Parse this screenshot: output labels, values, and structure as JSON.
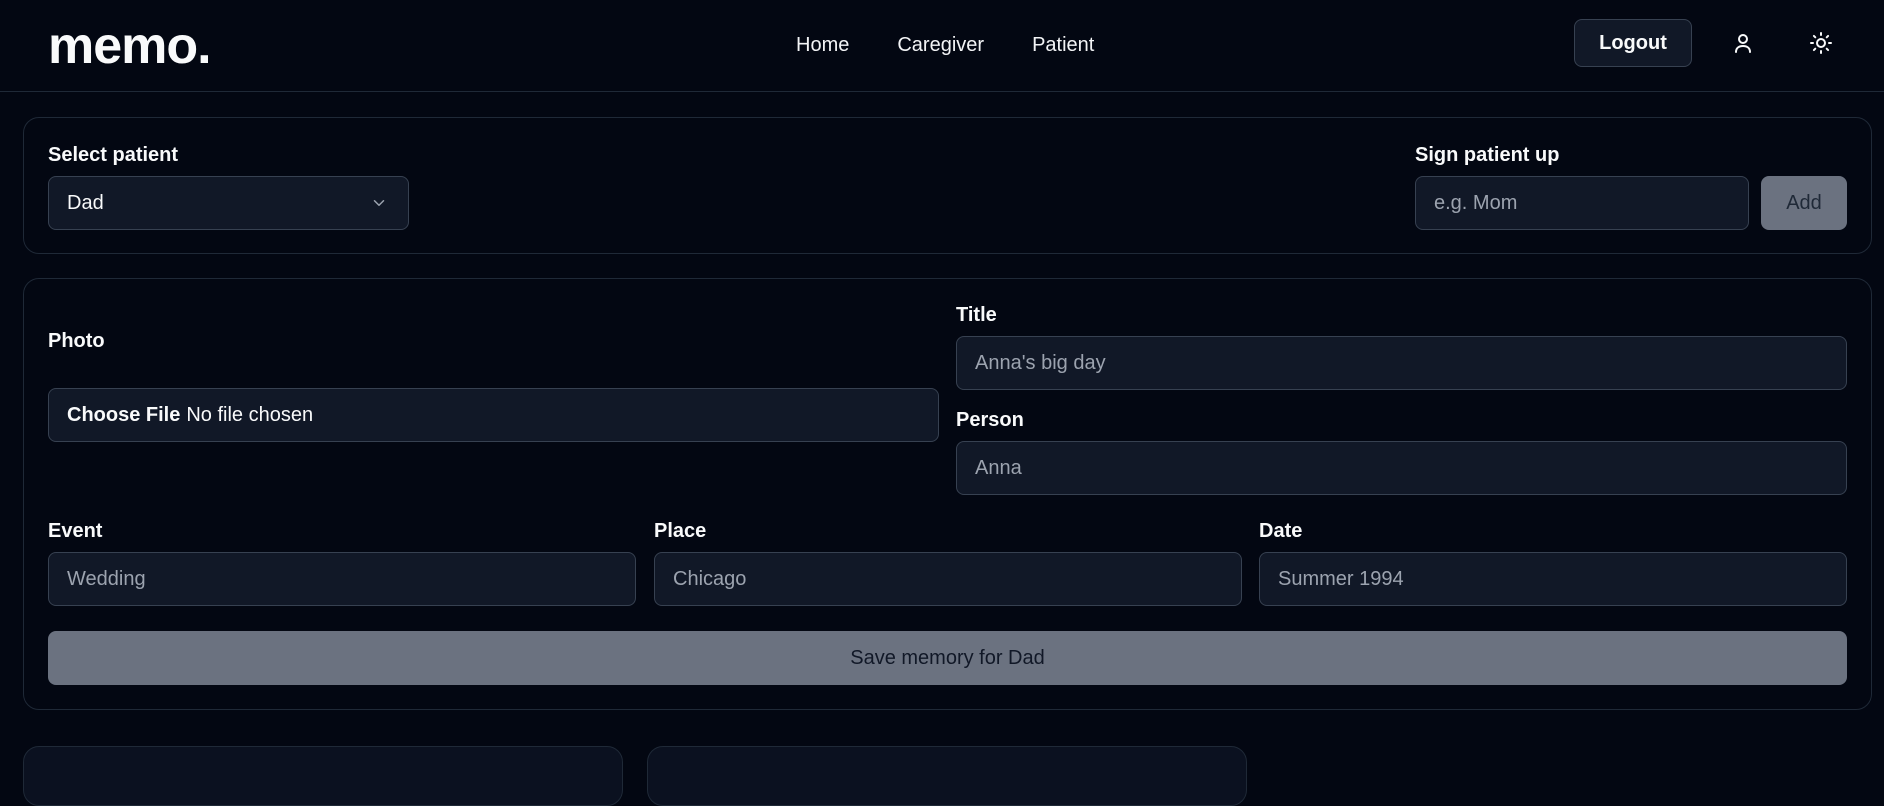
{
  "header": {
    "logo": "memo.",
    "nav": [
      "Home",
      "Caregiver",
      "Patient"
    ],
    "logout_label": "Logout",
    "user_icon": "user-icon",
    "theme_icon": "sun-icon"
  },
  "patient_panel": {
    "select_label": "Select patient",
    "selected_patient": "Dad",
    "signup_label": "Sign patient up",
    "signup_placeholder": "e.g. Mom",
    "add_label": "Add"
  },
  "memory_form": {
    "photo_label": "Photo",
    "file_button": "Choose File",
    "file_status": "No file chosen",
    "title_label": "Title",
    "title_placeholder": "Anna's big day",
    "person_label": "Person",
    "person_placeholder": "Anna",
    "event_label": "Event",
    "event_placeholder": "Wedding",
    "place_label": "Place",
    "place_placeholder": "Chicago",
    "date_label": "Date",
    "date_placeholder": "Summer 1994",
    "save_label": "Save memory for Dad"
  },
  "colors": {
    "background": "#030712",
    "field": "#111827",
    "border": "#374151",
    "button_disabled": "#6b7280"
  }
}
